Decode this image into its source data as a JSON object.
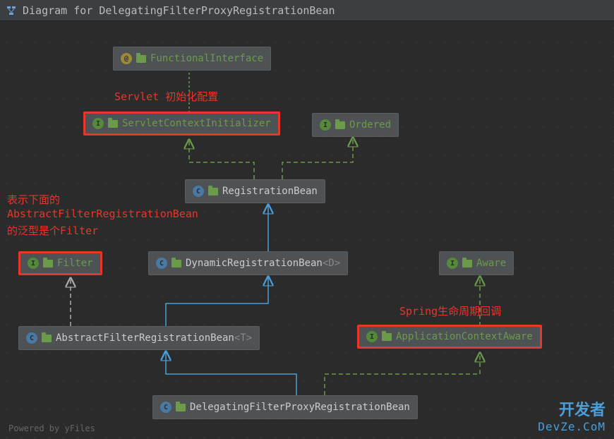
{
  "header": {
    "title": "Diagram for DelegatingFilterProxyRegistrationBean"
  },
  "nodes": {
    "functionalInterface": {
      "label": "FunctionalInterface",
      "type": "annotation"
    },
    "servletContextInitializer": {
      "label": "ServletContextInitializer",
      "type": "interface"
    },
    "ordered": {
      "label": "Ordered",
      "type": "interface"
    },
    "registrationBean": {
      "label": "RegistrationBean",
      "type": "class"
    },
    "filter": {
      "label": "Filter",
      "type": "interface"
    },
    "dynamicRegistrationBean": {
      "label": "DynamicRegistrationBean",
      "generic": "<D>",
      "type": "class"
    },
    "aware": {
      "label": "Aware",
      "type": "interface"
    },
    "abstractFilterRegistrationBean": {
      "label": "AbstractFilterRegistrationBean",
      "generic": "<T>",
      "type": "class"
    },
    "applicationContextAware": {
      "label": "ApplicationContextAware",
      "type": "interface"
    },
    "delegatingFilterProxyRegistrationBean": {
      "label": "DelegatingFilterProxyRegistrationBean",
      "type": "class"
    }
  },
  "annotations": {
    "servletAnnotation": "Servlet 初始化配置",
    "filterAnnotation1": "表示下面的",
    "filterAnnotation2": "AbstractFilterRegistrationBean",
    "filterAnnotation3": "的泛型是个Filter",
    "springAnnotation": "Spring生命周期回调"
  },
  "footer": "Powered by yFiles",
  "watermark": {
    "main": "开发者",
    "sub": "DevZe.CoM"
  }
}
